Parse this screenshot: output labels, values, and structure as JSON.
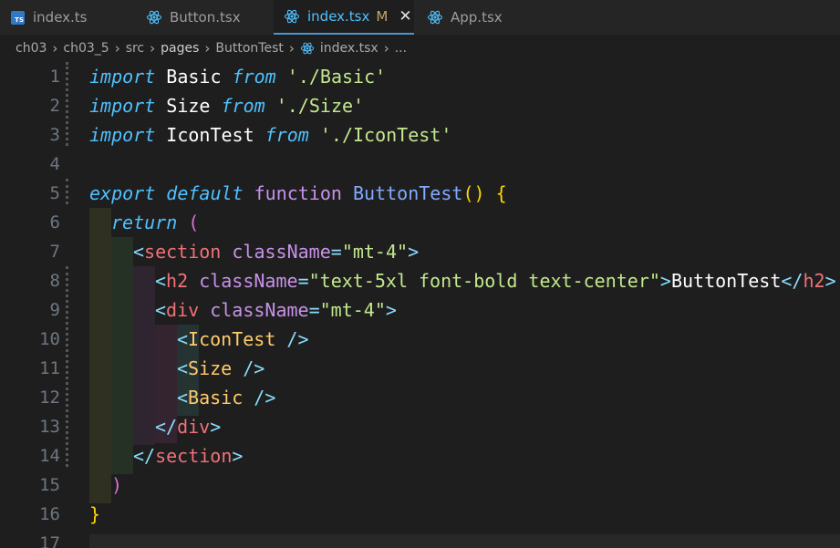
{
  "tabs": [
    {
      "label": "index.ts",
      "icon": "typescript-icon",
      "badge": "TS",
      "active": false
    },
    {
      "label": "Button.tsx",
      "icon": "react-icon",
      "active": false
    },
    {
      "label": "index.tsx",
      "icon": "react-icon",
      "active": true,
      "modified": "M",
      "close": "✕"
    },
    {
      "label": "App.tsx",
      "icon": "react-icon",
      "active": false
    }
  ],
  "breadcrumb": [
    "ch03",
    "ch03_5",
    "src",
    "pages",
    "ButtonTest",
    "index.tsx",
    "..."
  ],
  "line_numbers": [
    "1",
    "2",
    "3",
    "4",
    "5",
    "6",
    "7",
    "8",
    "9",
    "10",
    "11",
    "12",
    "13",
    "14",
    "15",
    "16",
    "17"
  ],
  "code": {
    "l1": [
      "import",
      "Basic",
      "from",
      "'./Basic'"
    ],
    "l2": [
      "import",
      "Size",
      "from",
      "'./Size'"
    ],
    "l3": [
      "import",
      "IconTest",
      "from",
      "'./IconTest'"
    ],
    "l5": [
      "export",
      "default",
      "function",
      "ButtonTest",
      "()",
      "{"
    ],
    "l6": [
      "return",
      "("
    ],
    "l7": [
      "<",
      "section",
      "className",
      "=",
      "\"mt-4\"",
      ">"
    ],
    "l8": [
      "<",
      "h2",
      "className",
      "=",
      "\"text-5xl font-bold text-center\"",
      ">",
      "ButtonTest",
      "</",
      "h2",
      ">"
    ],
    "l9": [
      "<",
      "div",
      "className",
      "=",
      "\"mt-4\"",
      ">"
    ],
    "l10": [
      "<",
      "IconTest",
      " />"
    ],
    "l11": [
      "<",
      "Size",
      " />"
    ],
    "l12": [
      "<",
      "Basic",
      " />"
    ],
    "l13": [
      "</",
      "div",
      ">"
    ],
    "l14": [
      "</",
      "section",
      ">"
    ],
    "l15": [
      ")"
    ],
    "l16": [
      "}"
    ]
  },
  "colors": {
    "editor_bg": "#1e1e1e",
    "tabbar_bg": "#252526",
    "active_tab_text": "#4fc1ff",
    "modified_marker": "#c0a76a"
  }
}
